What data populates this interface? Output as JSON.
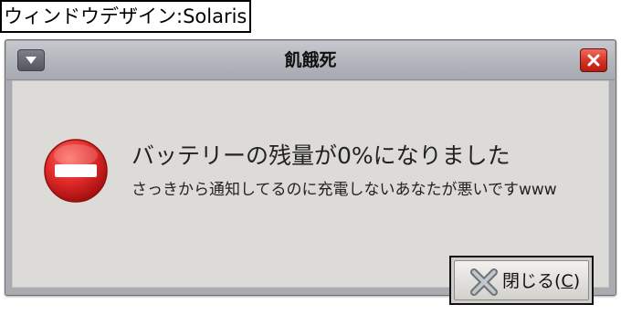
{
  "caption": {
    "text": "ウィンドウデザイン:Solaris"
  },
  "window": {
    "title": "飢餓死",
    "menu_icon": "chevron-down-icon",
    "close_icon": "close-icon"
  },
  "dialog": {
    "icon": "error-icon",
    "heading": "バッテリーの残量が0%になりました",
    "message": "さっきから通知してるのに充電しないあなたが悪いですwww",
    "close_button": {
      "icon": "close-x-icon",
      "label_prefix": "閉じる(",
      "mnemonic": "C",
      "label_suffix": ")"
    }
  },
  "colors": {
    "titlebar": "#b4b7bd",
    "client_bg": "#dddbd7",
    "close_red": "#d33222",
    "error_red": "#e12a2a"
  }
}
